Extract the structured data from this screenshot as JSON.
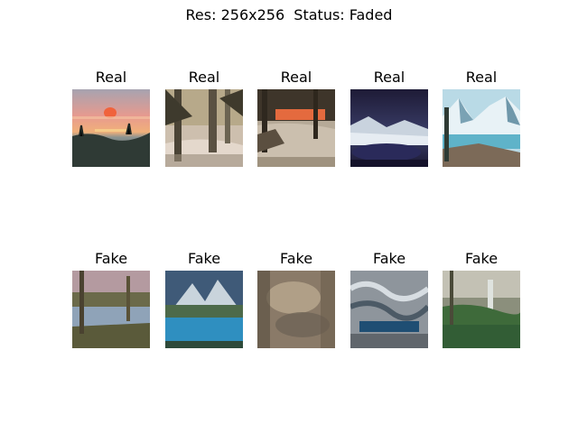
{
  "figure_title": "Res: 256x256  Status: Faded",
  "rows": [
    {
      "panels": [
        {
          "title": "Real",
          "image": "sunset-lake-painting"
        },
        {
          "title": "Real",
          "image": "winter-forest-painting"
        },
        {
          "title": "Real",
          "image": "snowy-woods-sunset-painting"
        },
        {
          "title": "Real",
          "image": "night-snow-lake-painting"
        },
        {
          "title": "Real",
          "image": "mountain-lake-painting"
        }
      ]
    },
    {
      "panels": [
        {
          "title": "Fake",
          "image": "generated-lake-trees"
        },
        {
          "title": "Fake",
          "image": "generated-mountain-lake"
        },
        {
          "title": "Fake",
          "image": "generated-blurry-landscape"
        },
        {
          "title": "Fake",
          "image": "generated-wave-landscape"
        },
        {
          "title": "Fake",
          "image": "generated-forest-waterfall"
        }
      ]
    }
  ]
}
